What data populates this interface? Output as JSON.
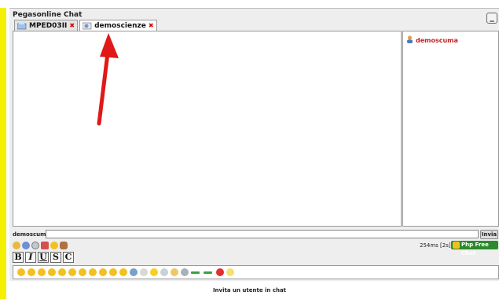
{
  "window": {
    "title": "Pegasonline Chat",
    "minimize_label": "_"
  },
  "tabs": [
    {
      "label": "MPED03II",
      "active": false
    },
    {
      "label": "demoscienze",
      "active": true
    }
  ],
  "users": [
    {
      "name": "demoscuma"
    }
  ],
  "composer": {
    "nickname": "demoscuma",
    "input_value": "",
    "send_label": "Invia"
  },
  "status": {
    "ping": "254ms [2s]",
    "brand": "Php Free Chat"
  },
  "format_buttons": [
    "B",
    "I",
    "U",
    "S",
    "C"
  ],
  "footer": {
    "invite_link": "Invita un utente in chat"
  },
  "colors": {
    "accent_red": "#e01818",
    "left_bar": "#f5f000",
    "nick_color": "#c02020",
    "brand_green": "#2b8a2b"
  }
}
